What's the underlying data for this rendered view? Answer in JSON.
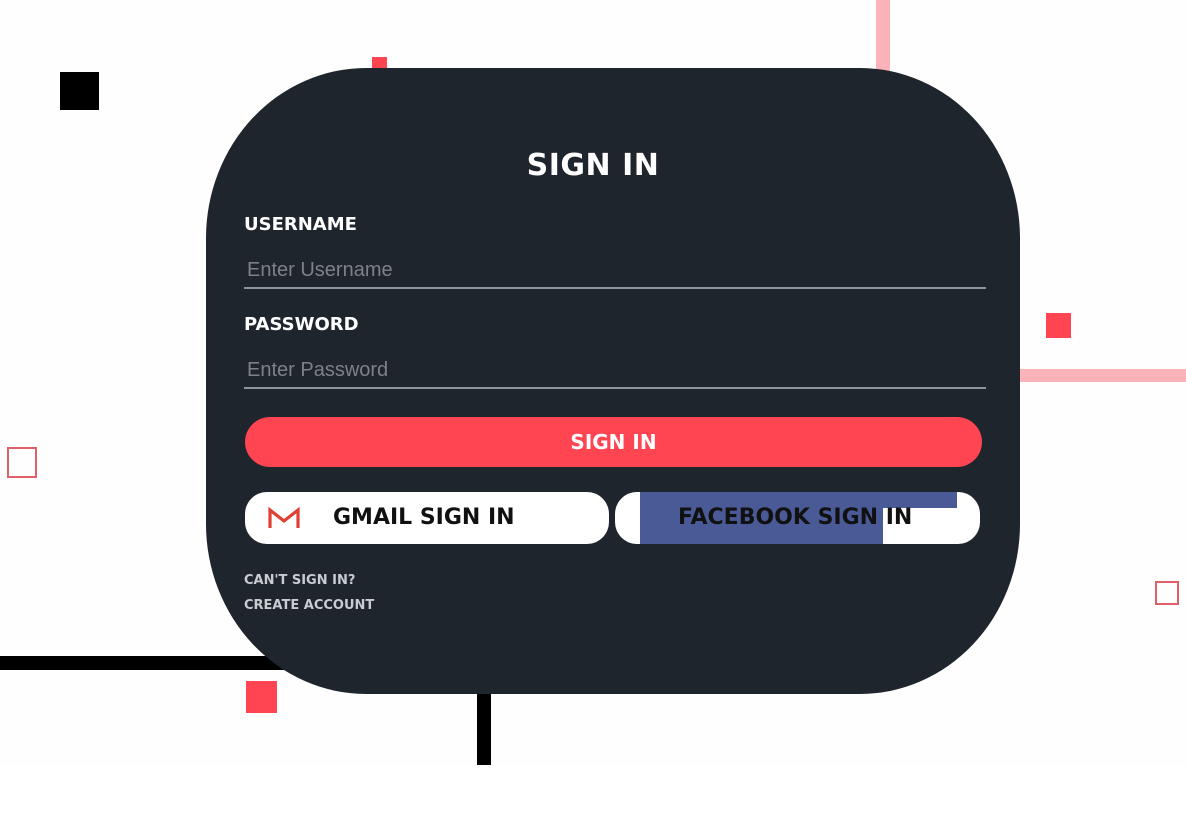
{
  "form": {
    "title": "SIGN IN",
    "username_label": "USERNAME",
    "username_placeholder": "Enter Username",
    "password_label": "PASSWORD",
    "password_placeholder": "Enter Password",
    "signin_label": "SIGN IN",
    "gmail_label": "GMAIL SIGN IN",
    "facebook_label": "FACEBOOK SIGN IN",
    "cant_signin_label": "CAN'T SIGN IN?",
    "create_account_label": "CREATE ACCOUNT"
  },
  "icons": {
    "gmail": "gmail-icon"
  },
  "colors": {
    "card": "#1f252d",
    "accent": "#ff4552",
    "facebook": "#4a5a96",
    "pink_line": "#fbb2b8",
    "black": "#000000"
  }
}
